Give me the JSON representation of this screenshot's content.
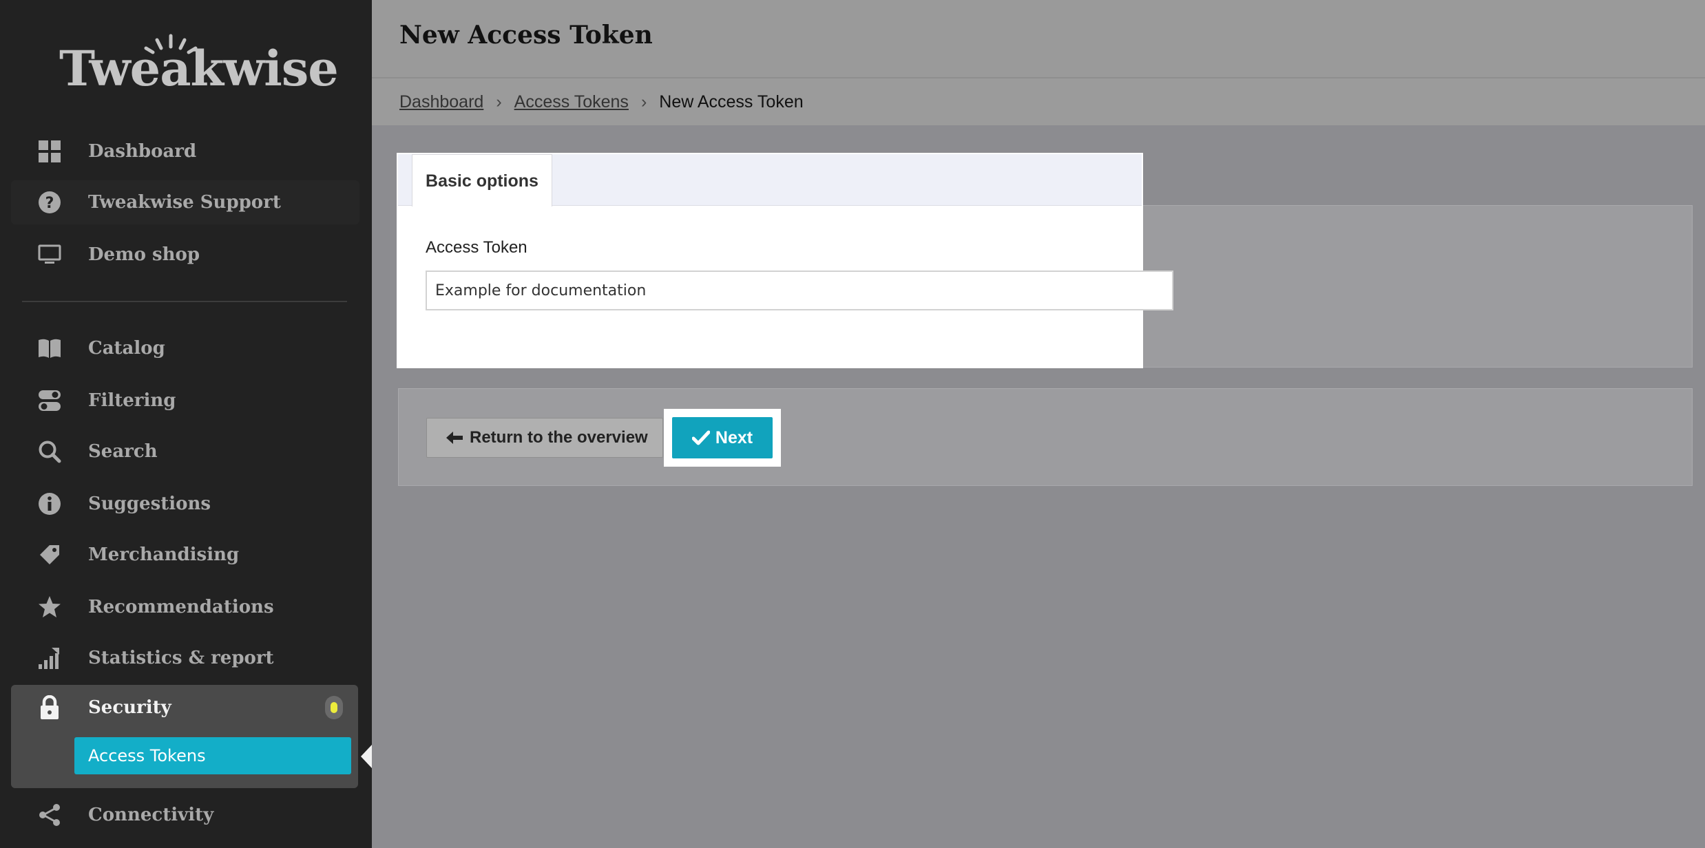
{
  "app": {
    "logo_text": "Tweakwise",
    "brand_accent": "#13aec8"
  },
  "sidebar": {
    "items": [
      {
        "id": "dashboard",
        "label": "Dashboard",
        "icon": "grid-icon"
      },
      {
        "id": "support",
        "label": "Tweakwise Support",
        "icon": "question-circle-icon"
      },
      {
        "id": "demo",
        "label": "Demo shop",
        "icon": "monitor-icon"
      },
      {
        "id": "catalog",
        "label": "Catalog",
        "icon": "book-icon"
      },
      {
        "id": "filtering",
        "label": "Filtering",
        "icon": "toggles-icon"
      },
      {
        "id": "search",
        "label": "Search",
        "icon": "search-icon"
      },
      {
        "id": "suggestions",
        "label": "Suggestions",
        "icon": "info-circle-icon"
      },
      {
        "id": "merchandising",
        "label": "Merchandising",
        "icon": "tag-icon"
      },
      {
        "id": "recommendations",
        "label": "Recommendations",
        "icon": "star-icon"
      },
      {
        "id": "statistics",
        "label": "Statistics & report",
        "icon": "chart-icon"
      },
      {
        "id": "security",
        "label": "Security",
        "icon": "lock-icon"
      },
      {
        "id": "connectivity",
        "label": "Connectivity",
        "icon": "share-icon"
      }
    ],
    "security_subitems": [
      {
        "label": "Access Tokens"
      }
    ]
  },
  "header": {
    "title": "New Access Token"
  },
  "breadcrumb": {
    "items": [
      "Dashboard",
      "Access Tokens"
    ],
    "current": "New Access Token",
    "separator": "›"
  },
  "form": {
    "tabs": [
      {
        "label": "Basic options"
      }
    ],
    "field_label": "Access Token",
    "field_value": "Example for documentation"
  },
  "actions": {
    "return_label": "Return to the overview",
    "next_label": "Next"
  }
}
